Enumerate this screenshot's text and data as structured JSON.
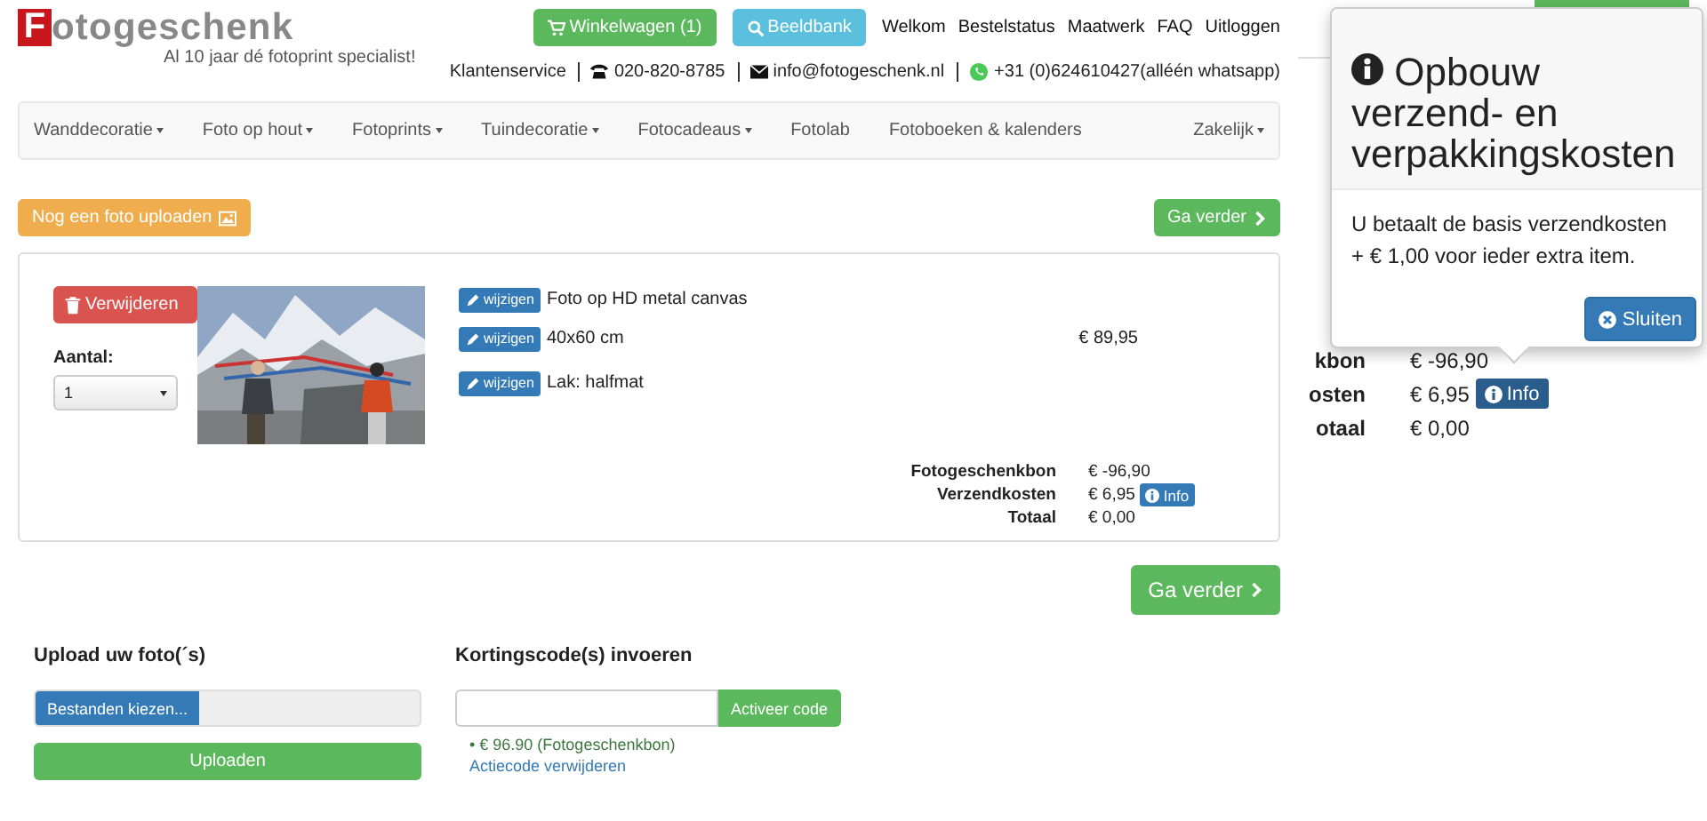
{
  "logo": {
    "letter": "F",
    "name": "otogeschenk",
    "tagline": "Al 10 jaar dé fotoprint specialist!"
  },
  "top_buttons": [
    {
      "label": "Winkelwagen (1)",
      "kind": "cart"
    },
    {
      "label": "Beeldbank",
      "kind": "search"
    }
  ],
  "top_links": [
    "Welkom",
    "Bestelstatus",
    "Maatwerk",
    "FAQ",
    "Uitloggen"
  ],
  "contact": [
    {
      "kind": "text",
      "label": "Klantenservice"
    },
    {
      "kind": "phone",
      "label": "020-820-8785"
    },
    {
      "kind": "mail",
      "label": "info@fotogeschenk.nl"
    },
    {
      "kind": "whatsapp",
      "label": "+31 (0)624610427(alléén whatsapp)"
    }
  ],
  "nav": {
    "items": [
      {
        "label": "Wanddecoratie",
        "dropdown": true
      },
      {
        "label": "Foto op hout",
        "dropdown": true
      },
      {
        "label": "Fotoprints",
        "dropdown": true
      },
      {
        "label": "Tuindecoratie",
        "dropdown": true
      },
      {
        "label": "Fotocadeaus",
        "dropdown": true
      },
      {
        "label": "Fotolab",
        "dropdown": false
      },
      {
        "label": "Fotoboeken & kalenders",
        "dropdown": false
      }
    ],
    "right": {
      "label": "Zakelijk",
      "dropdown": true
    }
  },
  "upload_more_button": "Nog een foto uploaden",
  "continue_button": "Ga verder",
  "cart_item": {
    "remove_button": "Verwijderen",
    "quantity_label": "Aantal:",
    "quantity": "1",
    "options": [
      {
        "edit": "wijzigen",
        "text": "Foto op HD metal canvas"
      },
      {
        "edit": "wijzigen",
        "text": "40x60 cm",
        "price": "€ 89,95"
      },
      {
        "edit": "wijzigen",
        "text": "Lak: halfmat"
      }
    ]
  },
  "totals": [
    {
      "label": "Fotogeschenkbon",
      "value": "€ -96,90"
    },
    {
      "label": "Verzendkosten",
      "value": "€ 6,95",
      "info": "Info"
    },
    {
      "label": "Totaal",
      "value": "€ 0,00"
    }
  ],
  "continue_button_large": "Ga verder",
  "upload": {
    "title": "Upload uw foto(´s)",
    "choose_button": "Bestanden kiezen...",
    "upload_button": "Uploaden"
  },
  "discount": {
    "title": "Kortingscode(s) invoeren",
    "activate_button": "Activeer code",
    "applied": "• € 96.90 (Fotogeschenkbon)",
    "remove_link": "Actiecode verwijderen"
  },
  "side_summary": [
    {
      "label": "kbon",
      "value": "€ -96,90"
    },
    {
      "label": "osten",
      "value": "€ 6,95",
      "info": "Info"
    },
    {
      "label": "otaal",
      "value": "€ 0,00"
    }
  ],
  "popover": {
    "title": "Opbouw verzend- en verpakkingskosten",
    "body": "U betaalt de basis verzendkosten + € 1,00 voor ieder extra item.",
    "close_button": "Sluiten"
  }
}
